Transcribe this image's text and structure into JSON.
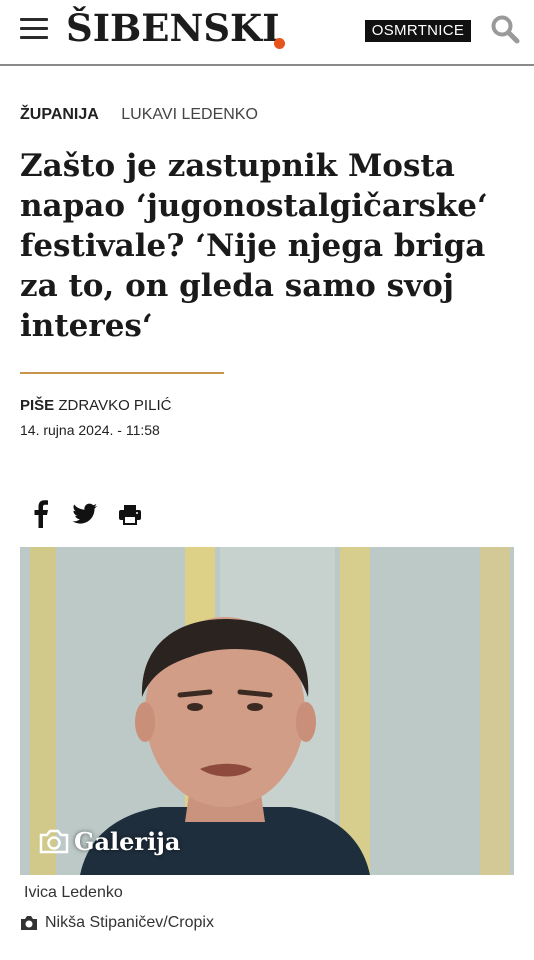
{
  "header": {
    "logo_text": "ŠIBENSKI",
    "osmrtnice_label": "OSMRTNICE"
  },
  "article": {
    "category": "ŽUPANIJA",
    "tag": "LUKAVI LEDENKO",
    "headline": "Zašto je zastupnik Mosta napao ‘jugonostalgičarske‘ festivale? ‘Nije njega briga za to, on gleda samo svoj interes‘",
    "byline_prefix": "PIŠE",
    "author": "ZDRAVKO PILIĆ",
    "date": "14. rujna 2024. - 11:58"
  },
  "share": {
    "icons": [
      "facebook-icon",
      "twitter-icon",
      "print-icon"
    ]
  },
  "media": {
    "gallery_label": "Galerija",
    "caption": "Ivica Ledenko",
    "credit": "Nikša Stipaničev/Cropix"
  },
  "colors": {
    "accent": "#e6531c",
    "divider": "#c8934c",
    "badge_bg": "#111111"
  }
}
